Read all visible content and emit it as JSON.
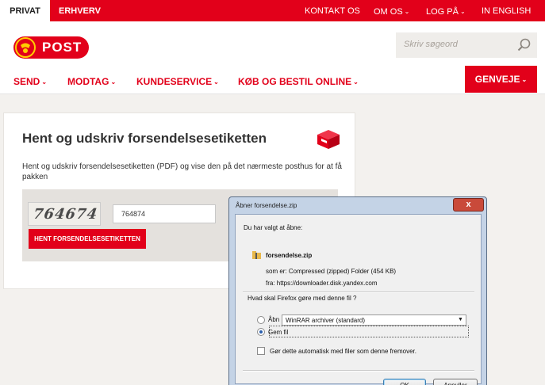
{
  "topbar": {
    "tab_private": "PRIVAT",
    "tab_business": "ERHVERV",
    "links": {
      "contact": "KONTAKT OS",
      "about": "OM OS",
      "login": "LOG PÅ",
      "english": "IN ENGLISH"
    }
  },
  "header": {
    "logo_text": "POST",
    "search_placeholder": "Skriv søgeord",
    "nav": {
      "send": "SEND",
      "receive": "MODTAG",
      "service": "KUNDESERVICE",
      "shop": "KØB OG BESTIL ONLINE"
    },
    "shortcuts": "GENVEJE"
  },
  "card": {
    "title": "Hent og udskriv forsendelsesetiketten",
    "description": "Hent og udskriv forsendelsesetiketten (PDF) og vise den på det nærmeste posthus for at få pakken",
    "captcha_text": "764674",
    "captcha_input_value": "764874",
    "button_label": "HENT FORSENDELSESETIKETTEN"
  },
  "dialog": {
    "title": "Åbner forsendelse.zip",
    "intro": "Du har valgt at åbne:",
    "filename": "forsendelse.zip",
    "type_line": "som er:  Compressed (zipped) Folder (454 KB)",
    "from_line": "fra:  https://downloader.disk.yandex.com",
    "question": "Hvad skal Firefox gøre med denne fil ?",
    "open_with_label": "Åbn med",
    "open_with_app": "WinRAR archiver (standard)",
    "save_label": "Gem fil",
    "auto_label": "Gør dette automatisk med filer som denne fremover.",
    "ok_label": "OK",
    "cancel_label": "Annuller",
    "close_glyph": "x"
  },
  "colors": {
    "brand_red": "#e2001a",
    "dialog_frame": "#c4d3e6"
  }
}
